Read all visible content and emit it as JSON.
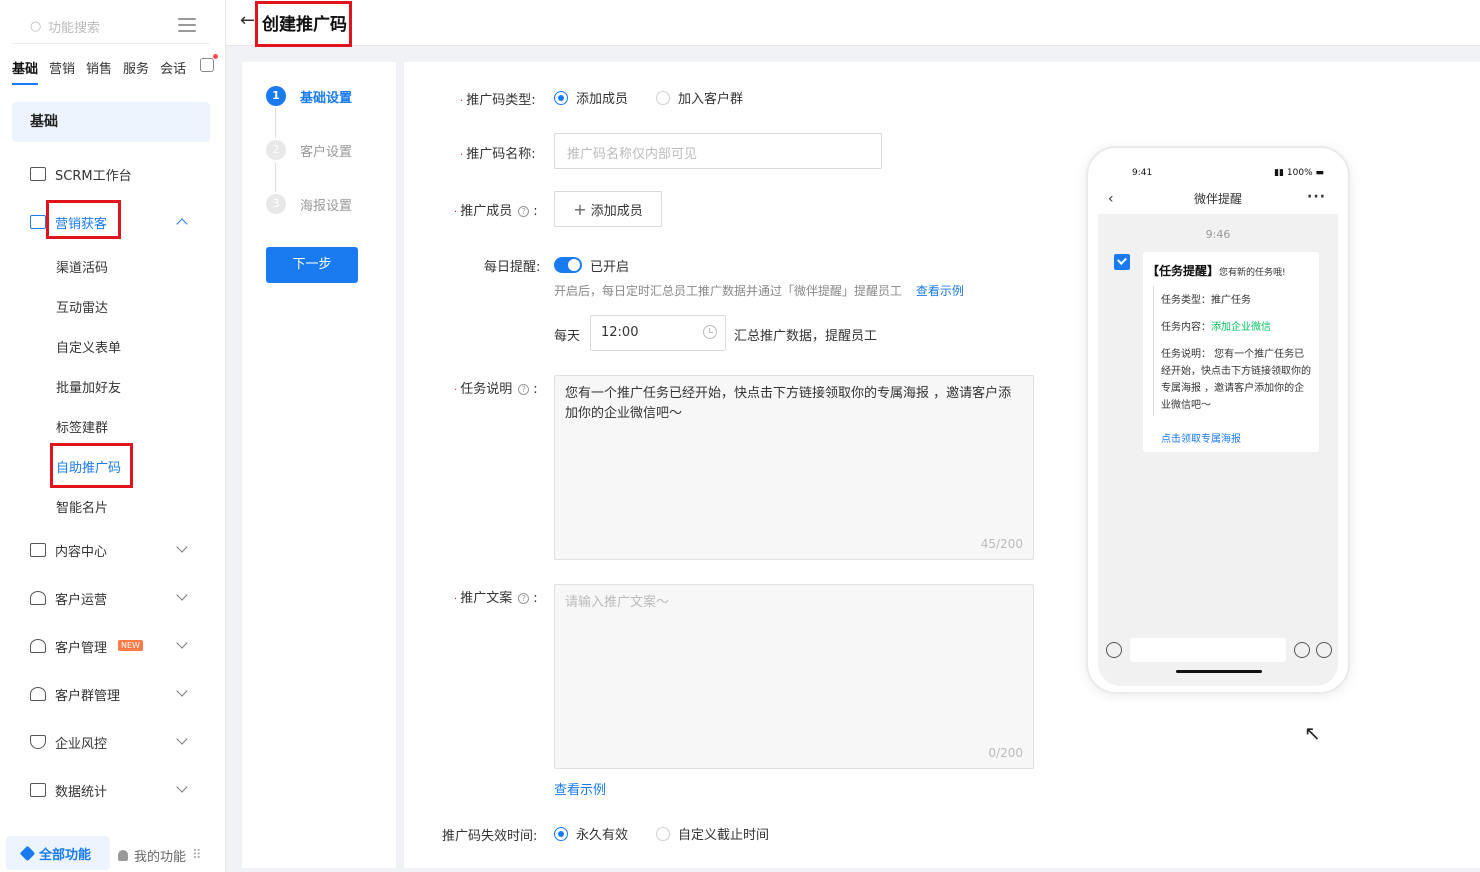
{
  "sidebar": {
    "search_placeholder": "功能搜索",
    "tabs": [
      "基础",
      "营销",
      "销售",
      "服务",
      "会话"
    ],
    "group_title": "基础",
    "nav": {
      "workbench": "SCRM工作台",
      "marketing": "营销获客",
      "content": "内容中心",
      "customer_ops": "客户运营",
      "customer_mgmt": "客户管理",
      "customer_mgmt_badge": "NEW",
      "group_mgmt": "客户群管理",
      "risk": "企业风控",
      "stats": "数据统计"
    },
    "sub_items": [
      "渠道活码",
      "互动雷达",
      "自定义表单",
      "批量加好友",
      "标签建群",
      "自助推广码",
      "智能名片"
    ],
    "all_functions": "全部功能",
    "my_functions": "我的功能"
  },
  "header": {
    "back_icon": "←",
    "title": "创建推广码"
  },
  "steps": {
    "items": [
      {
        "num": "1",
        "label": "基础设置"
      },
      {
        "num": "2",
        "label": "客户设置"
      },
      {
        "num": "3",
        "label": "海报设置"
      }
    ],
    "next_button": "下一步"
  },
  "form": {
    "type_label": "推广码类型:",
    "type_options": [
      "添加成员",
      "加入客户群"
    ],
    "type_selected": "添加成员",
    "name_label": "推广码名称:",
    "name_placeholder": "推广码名称仅内部可见",
    "member_label": "推广成员",
    "add_member_button": "添加成员",
    "reminder_label": "每日提醒:",
    "reminder_state": "已开启",
    "reminder_hint": "开启后，每日定时汇总员工推广数据并通过「微伴提醒」提醒员工",
    "view_example": "查看示例",
    "daily_prefix": "每天",
    "daily_time": "12:00",
    "daily_suffix": "汇总推广数据，提醒员工",
    "task_label": "任务说明",
    "task_text": "您有一个推广任务已经开始，快点击下方链接领取你的专属海报 ，邀请客户添加你的企业微信吧～",
    "task_count": "45/200",
    "copy_label": "推广文案",
    "copy_placeholder": "请输入推广文案～",
    "copy_count": "0/200",
    "copy_example": "查看示例",
    "expire_label": "推广码失效时间:",
    "expire_options": [
      "永久有效",
      "自定义截止时间"
    ],
    "expire_selected": "永久有效"
  },
  "preview": {
    "status_time": "9:41",
    "battery": "100%",
    "chat_title": "微伴提醒",
    "message_time": "9:46",
    "card_title": "【任务提醒】",
    "card_subtitle": "您有新的任务哦!",
    "task_type": "任务类型：推广任务",
    "task_content_prefix": "任务内容：",
    "task_content_value": "添加企业微信",
    "task_desc": "任务说明： 您有一个推广任务已经开始，快点击下方链接领取你的专属海报 ，邀请客户添加你的企业微信吧～",
    "card_link": "点击领取专属海报"
  },
  "colors": {
    "primary": "#1a7bf0",
    "highlight_box": "#e0141e",
    "wechat_green": "#07c160"
  }
}
